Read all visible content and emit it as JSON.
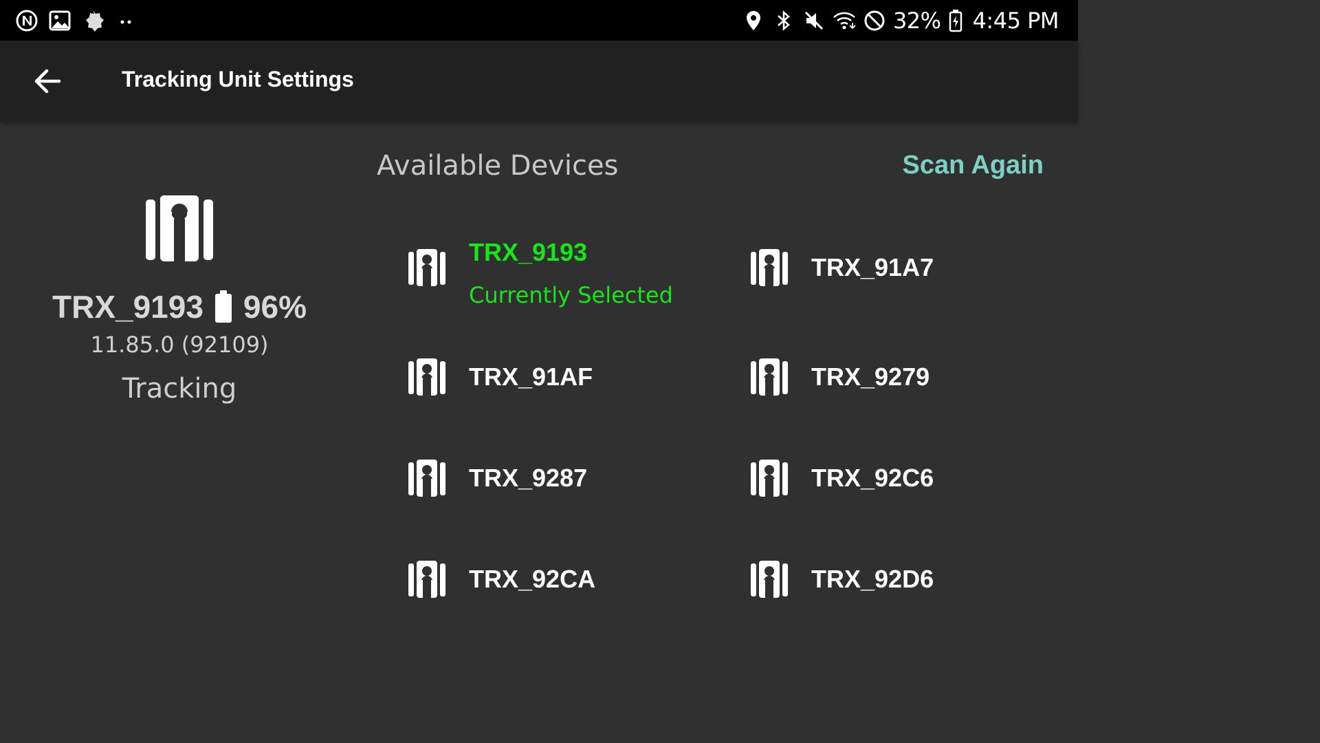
{
  "status_bar": {
    "left_icons": [
      "n-notification-icon",
      "gallery-icon",
      "settings-badge-icon",
      "more-dots-icon"
    ],
    "right_icons": [
      "location-icon",
      "bluetooth-icon",
      "mute-icon",
      "wifi-icon",
      "do-not-disturb-icon"
    ],
    "battery_percent": "32%",
    "time": "4:45 PM"
  },
  "appbar": {
    "title": "Tracking Unit Settings"
  },
  "current": {
    "name": "TRX_9193",
    "battery": "96%",
    "version": "11.85.0 (92109)",
    "status": "Tracking"
  },
  "available": {
    "title": "Available Devices",
    "scan_label": "Scan Again",
    "selected_label": "Currently Selected",
    "devices": [
      {
        "name": "TRX_9193"
      },
      {
        "name": "TRX_91A7"
      },
      {
        "name": "TRX_91AF"
      },
      {
        "name": "TRX_9279"
      },
      {
        "name": "TRX_9287"
      },
      {
        "name": "TRX_92C6"
      },
      {
        "name": "TRX_92CA"
      },
      {
        "name": "TRX_92D6"
      }
    ]
  },
  "colors": {
    "background": "#303030",
    "appbar": "#212121",
    "accent": "#7ed0c4",
    "selected": "#17e617"
  }
}
